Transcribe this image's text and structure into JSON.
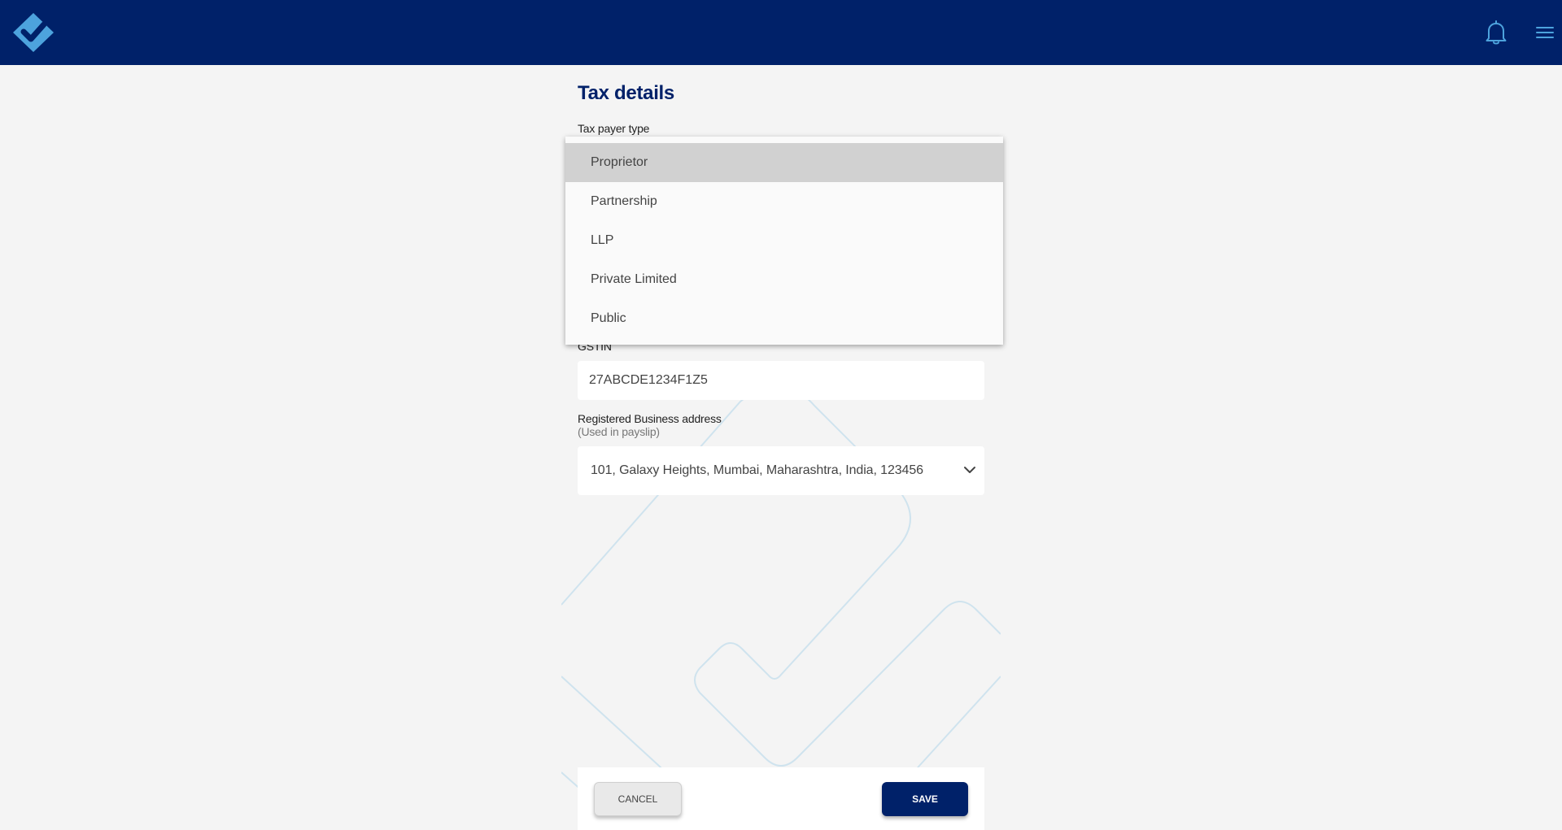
{
  "header": {
    "logo_icon": "check-diamond-logo",
    "notification_icon": "bell-icon",
    "menu_icon": "hamburger-menu-icon"
  },
  "page": {
    "title": "Tax details"
  },
  "tax_payer_type": {
    "label": "Tax payer type",
    "options": [
      "Proprietor",
      "Partnership",
      "LLP",
      "Private Limited",
      "Public"
    ],
    "highlighted": "Proprietor"
  },
  "gstin": {
    "label": "GSTIN",
    "value": "27ABCDE1234F1Z5"
  },
  "business_address": {
    "label": "Registered Business address",
    "sublabel": "(Used in payslip)",
    "value": "101, Galaxy Heights, Mumbai, Maharashtra, India, 123456"
  },
  "footer": {
    "cancel_label": "CANCEL",
    "save_label": "SAVE"
  },
  "colors": {
    "brand": "#002169",
    "accent": "#4da3dd",
    "background": "#f4f4f4"
  }
}
